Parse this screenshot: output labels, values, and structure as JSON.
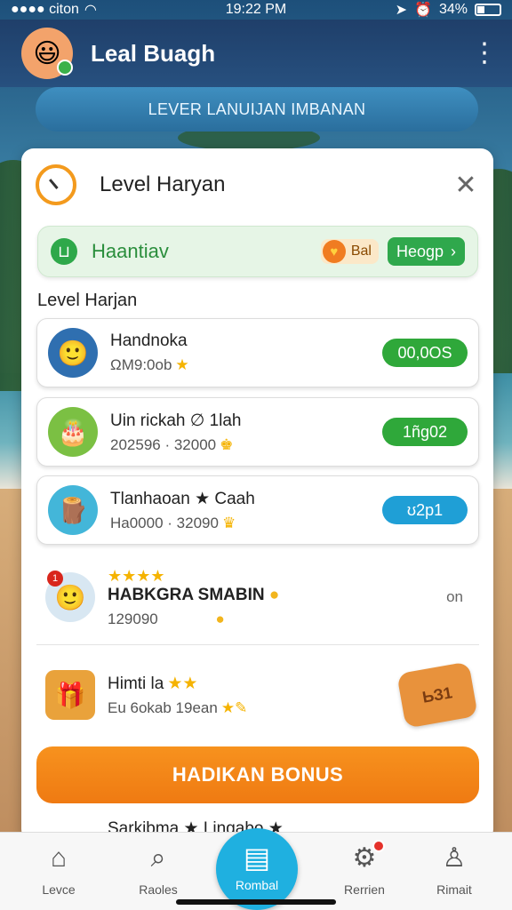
{
  "status_bar": {
    "carrier": "●●●● citon",
    "time": "19:22 PM",
    "battery": "34%"
  },
  "header": {
    "title": "Leal Buagh",
    "menu_icon": "kebab-menu-icon"
  },
  "banner": {
    "label": "LEVER LANUIJAN IMBANAN"
  },
  "card": {
    "title": "Level Haryan",
    "promo": {
      "label": "Haantiav",
      "chip_label": "Bal",
      "button_label": "Heogp",
      "button_arrow": "›"
    },
    "section_label": "Level Harjan",
    "rows": [
      {
        "name": "Handnoka",
        "sub": "ΩM9:0ob",
        "sub_icon": "★",
        "action": "00,0OS",
        "action_color": "green",
        "avatar_glyph": "🙂",
        "avatar_bg": "#2f6fb0"
      },
      {
        "name": "Uin rickah ∅ 1lah",
        "sub": "202596 · 32000",
        "sub_icon": "♚",
        "action": "1ñg02",
        "action_color": "green",
        "avatar_glyph": "🎂",
        "avatar_bg": "#7bc043"
      },
      {
        "name": "Tlanhaoan ★ Caah",
        "sub": "Ha0000 · 32090",
        "sub_icon": "♛",
        "action": "ʊ2p1",
        "action_color": "blue",
        "avatar_glyph": "🪵",
        "avatar_bg": "#43b6d9"
      }
    ],
    "featured": {
      "rank": "1",
      "stars": "★★★★",
      "name": "HABKGRA SMABIN",
      "value": "129090",
      "side_text": "on"
    },
    "gift_row": {
      "name": "Himti la",
      "stars": "★★",
      "sub": "Eu 6okab 19ean",
      "sub_icon": "★✎",
      "bag_label": "ЬЗ1"
    },
    "bonus_button": "HADIKAN BONUS",
    "peek_row": {
      "name": "Sarkibma ★ Lingabo ★"
    }
  },
  "tabbar": {
    "tabs": [
      {
        "label": "Levce",
        "icon": "home-icon"
      },
      {
        "label": "Raoles",
        "icon": "search-icon"
      },
      {
        "label": "Rombal",
        "icon": "chat-icon"
      },
      {
        "label": "Rerrien",
        "icon": "game-icon"
      },
      {
        "label": "Rimait",
        "icon": "profile-icon"
      }
    ]
  },
  "colors": {
    "header_bg": "#27507f",
    "accent_green": "#2fa83a",
    "accent_blue": "#1f9fd6",
    "accent_orange": "#f7921e"
  }
}
